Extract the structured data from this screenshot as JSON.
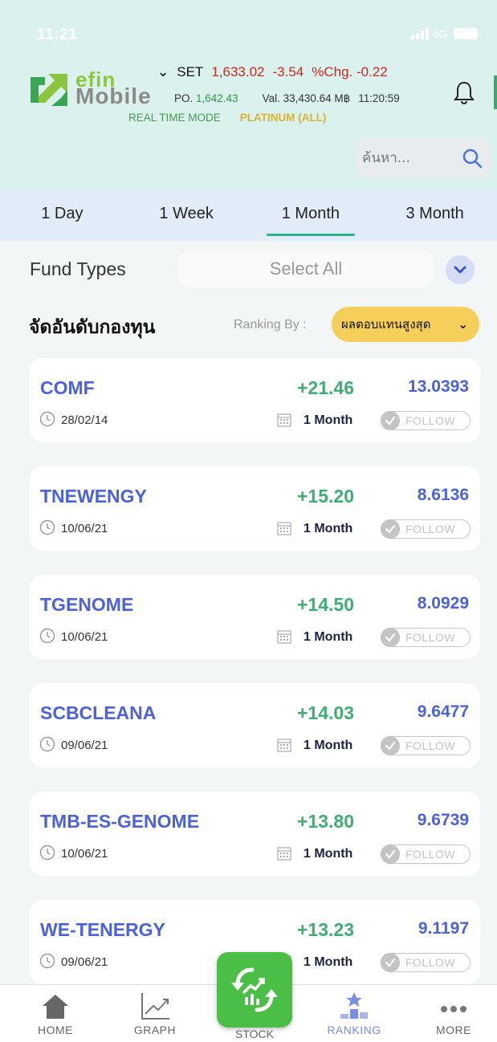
{
  "status_bar": {
    "time": "11:21",
    "network": "4G"
  },
  "header": {
    "logo_top": "efin",
    "logo_bottom": "Mobile",
    "market": {
      "dropdown_symbol": "⌄",
      "name": "SET",
      "index": "1,633.02",
      "change": "-3.54",
      "pct_change": "%Chg. -0.22",
      "po_label": "PO.",
      "po_value": "1,642.43",
      "value": "Val. 33,430.64 M฿",
      "time": "11:20:59",
      "mode": "REAL TIME MODE",
      "plan": "PLATINUM (ALL)"
    },
    "search_placeholder": "ค้นหา..."
  },
  "tabs": [
    {
      "label": "1 Day",
      "active": false
    },
    {
      "label": "1 Week",
      "active": false
    },
    {
      "label": "1 Month",
      "active": true
    },
    {
      "label": "3 Month",
      "active": false
    }
  ],
  "filter": {
    "label": "Fund Types",
    "value": "Select All"
  },
  "ranking": {
    "title": "จัดอันดับกองทุน",
    "by_label": "Ranking By :",
    "by_value": "ผลตอบแทนสูงสุด"
  },
  "funds": [
    {
      "code": "COMF",
      "change": "+21.46",
      "nav": "13.0393",
      "date": "28/02/14",
      "period": "1 Month",
      "follow": "FOLLOW"
    },
    {
      "code": "TNEWENGY",
      "change": "+15.20",
      "nav": "8.6136",
      "date": "10/06/21",
      "period": "1 Month",
      "follow": "FOLLOW"
    },
    {
      "code": "TGENOME",
      "change": "+14.50",
      "nav": "8.0929",
      "date": "10/06/21",
      "period": "1 Month",
      "follow": "FOLLOW"
    },
    {
      "code": "SCBCLEANA",
      "change": "+14.03",
      "nav": "9.6477",
      "date": "09/06/21",
      "period": "1 Month",
      "follow": "FOLLOW"
    },
    {
      "code": "TMB-ES-GENOME",
      "change": "+13.80",
      "nav": "9.6739",
      "date": "10/06/21",
      "period": "1 Month",
      "follow": "FOLLOW"
    },
    {
      "code": "WE-TENERGY",
      "change": "+13.23",
      "nav": "9.1197",
      "date": "09/06/21",
      "period": "1 Month",
      "follow": "FOLLOW"
    }
  ],
  "bottom_nav": [
    {
      "label": "HOME",
      "icon": "home-icon"
    },
    {
      "label": "GRAPH",
      "icon": "graph-icon"
    },
    {
      "label": "STOCK",
      "icon": "stock-icon"
    },
    {
      "label": "RANKING",
      "icon": "ranking-icon",
      "active": true
    },
    {
      "label": "MORE",
      "icon": "more-icon"
    }
  ],
  "colors": {
    "header_bg": "#daf1ee",
    "tab_bar_bg": "#e2ecf8",
    "tab_indicator": "#2db48a",
    "fund_code": "#4b62d8",
    "positive_change": "#3fae73",
    "market_negative": "#d0281f",
    "ranking_pill": "#f6cf5a",
    "stock_button": "#4bbf45",
    "nav_active": "#7a8ee3"
  }
}
